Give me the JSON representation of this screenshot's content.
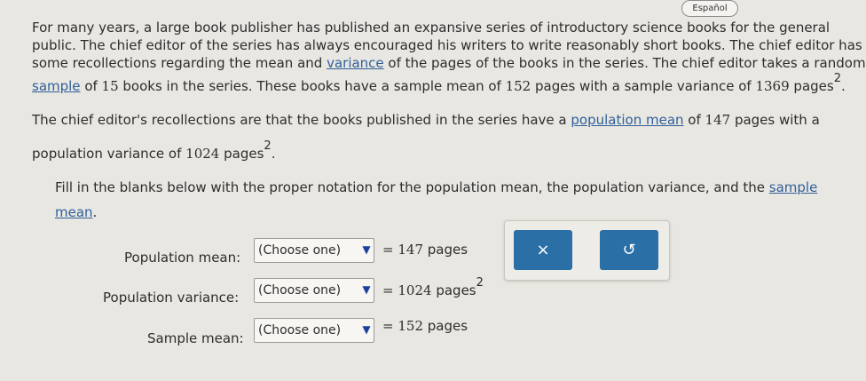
{
  "language_button": "Español",
  "problem": {
    "p1_l1": "For many years, a large book publisher has published an expansive series of introductory science books for the general",
    "p1_l2": "public. The chief editor of the series has always encouraged his writers to write reasonably short books. The chief editor has",
    "p1_l3a": "some recollections regarding the mean and ",
    "p1_l3_link": "variance",
    "p1_l3b": " of the pages of the books in the series. The chief editor takes a random",
    "p1_l4_link": "sample",
    "p1_l4a": " of ",
    "p1_l4_n": "15",
    "p1_l4b": " books in the series. These books have a sample mean of ",
    "p1_l4_mean": "152",
    "p1_l4c": " pages with a sample variance of ",
    "p1_l4_var": "1369",
    "p1_l4_unit": " pages",
    "p1_l4_exp": "2",
    "p1_l4_end": ".",
    "p2_l1a": "The chief editor's recollections are that the books published in the series have a ",
    "p2_l1_link": "population mean",
    "p2_l1b": " of ",
    "p2_l1_mean": "147",
    "p2_l1c": " pages with a",
    "p2_l2a": "population variance of ",
    "p2_l2_var": "1024",
    "p2_l2_unit": " pages",
    "p2_l2_exp": "2",
    "p2_l2_end": ".",
    "p3_l1a": "Fill in the blanks below with the proper notation for the population mean, the population variance, and the ",
    "p3_l1_link": "sample",
    "p3_l2_link": "mean",
    "p3_l2_end": "."
  },
  "rows": [
    {
      "label": "Population mean:",
      "select": "(Choose one)",
      "eq": "=",
      "value": "147",
      "unit": "pages",
      "exp": ""
    },
    {
      "label": "Population variance:",
      "select": "(Choose one)",
      "eq": "=",
      "value": "1024",
      "unit": "pages",
      "exp": "2"
    },
    {
      "label": "Sample mean:",
      "select": "(Choose one)",
      "eq": "=",
      "value": "152",
      "unit": "pages",
      "exp": ""
    }
  ],
  "actions": {
    "clear": "×",
    "undo": "↺"
  },
  "colors": {
    "accent": "#2a6fa6",
    "link": "#2f5f9a",
    "background": "#e9e7e2"
  }
}
